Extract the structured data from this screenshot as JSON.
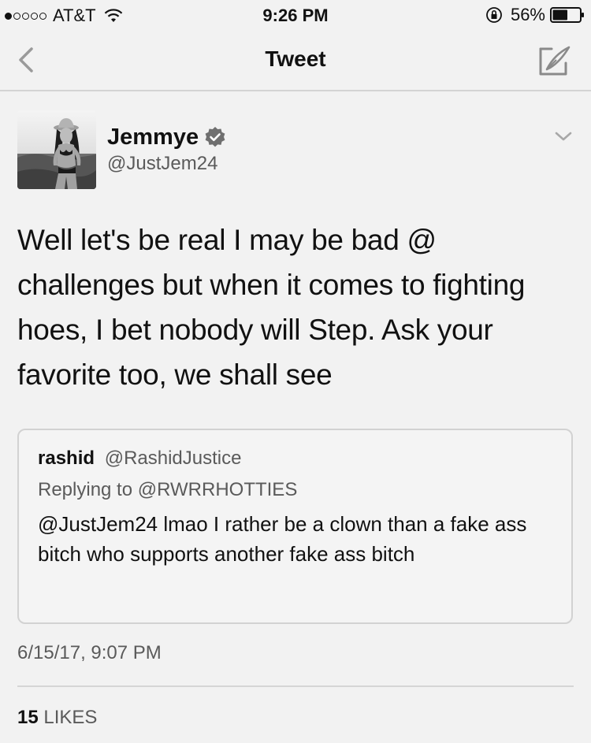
{
  "status_bar": {
    "carrier": "AT&T",
    "time": "9:26 PM",
    "battery": "56%",
    "signal_bars_filled": 1,
    "signal_bars_total": 5,
    "battery_level": 0.56
  },
  "nav": {
    "title": "Tweet",
    "back_icon": "chevron-left-icon",
    "compose_icon": "compose-tweet-icon"
  },
  "tweet": {
    "author_name": "Jemmye",
    "author_handle": "@JustJem24",
    "verified": true,
    "text": "Well let's be real I may be bad @ challenges but when it comes to fighting hoes, I bet nobody will Step. Ask your favorite too, we shall see",
    "timestamp": "6/15/17, 9:07 PM",
    "likes_count": "15",
    "likes_label": "LIKES"
  },
  "quoted_tweet": {
    "author_name": "rashid",
    "author_handle": "@RashidJustice",
    "replying_to": "Replying to @RWRRHOTTIES",
    "text": "@JustJem24 lmao I rather be a clown than a fake ass bitch who supports another fake ass bitch"
  }
}
